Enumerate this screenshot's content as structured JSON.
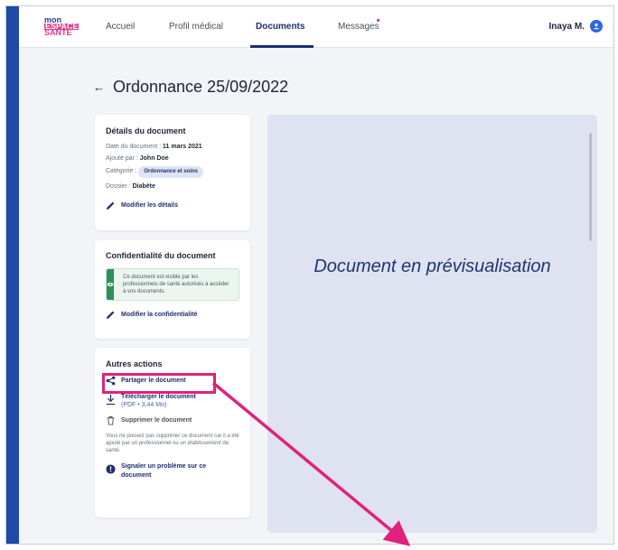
{
  "logo": {
    "line1": "mon",
    "line2": "ESPACE",
    "line3": "SANTÉ"
  },
  "nav": {
    "tabs": [
      {
        "label": "Accueil"
      },
      {
        "label": "Profil médical"
      },
      {
        "label": "Documents"
      },
      {
        "label": "Messages"
      }
    ],
    "active_tab": "Documents",
    "user_name": "Inaya M.",
    "user_icon": "user-avatar-icon"
  },
  "page": {
    "title": "Ordonnance 25/09/2022"
  },
  "details": {
    "title": "Détails du document",
    "date_label": "Date du document :",
    "date_value": "11 mars 2021",
    "added_label": "Ajouté par :",
    "added_value": "John Doe",
    "category_label": "Catégorie :",
    "category_value": "Ordonnance et soins",
    "folder_label": "Dossier :",
    "folder_value": "Diabète",
    "edit_label": "Modifier les détails"
  },
  "privacy": {
    "title": "Confidentialité du document",
    "notice": "Ce document est visible par les professionnels de santé autorisés à accéder à vos documents.",
    "edit_label": "Modifier la confidentialité"
  },
  "actions": {
    "title": "Autres actions",
    "share_label": "Partager le document",
    "download_label": "Télécharger le document",
    "download_meta": "(PDF • 3,44 Mo)",
    "delete_label": "Supprimer le document",
    "delete_note": "Vous ne pouvez pas supprimer ce document car il a été ajouté par un professionnel ou un établissement de santé.",
    "report_label": "Signaler un problème sur ce document"
  },
  "preview": {
    "text": "Document en prévisualisation"
  },
  "colors": {
    "brand_blue": "#1d2e6e",
    "annotation_pink": "#e0217d",
    "privacy_green": "#2f8f5b"
  }
}
